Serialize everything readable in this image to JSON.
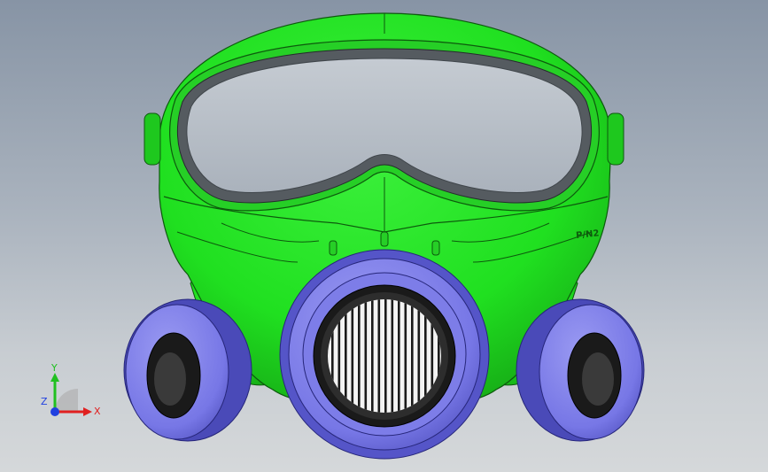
{
  "viewport": {
    "background_top": "#8794a5",
    "background_bottom": "#d5d8da"
  },
  "model": {
    "body_color": "#20e020",
    "body_dark": "#17a817",
    "lens_color": "#b9c0c8",
    "gasket_color": "#555b60",
    "filter_color": "#7777e6",
    "filter_dark": "#4a4ab8",
    "grille_dark": "#1a1a1a",
    "grille_light": "#f3f3f3",
    "side_tab_text": "P/N2"
  },
  "triad": {
    "x_label": "X",
    "y_label": "Y",
    "z_label": "Z",
    "x_color": "#e02020",
    "y_color": "#20c020",
    "z_color": "#2040e0"
  }
}
